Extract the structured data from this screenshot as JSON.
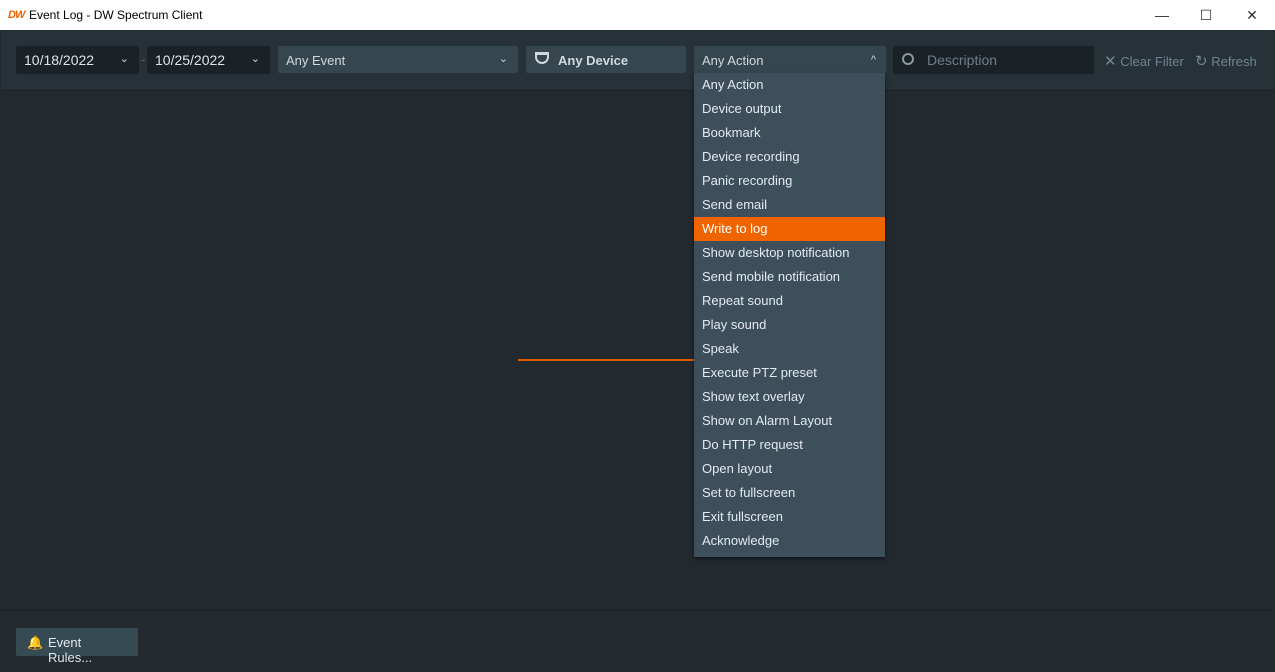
{
  "window": {
    "title": "Event Log - DW Spectrum Client",
    "logo": "DW"
  },
  "filters": {
    "date_from": "10/18/2022",
    "date_sep": "-",
    "date_to": "10/25/2022",
    "event": "Any Event",
    "device": "Any Device",
    "action": "Any Action",
    "description_placeholder": "Description",
    "clear_filter": "Clear Filter",
    "refresh": "Refresh"
  },
  "action_menu": {
    "selected_index": 6,
    "items": [
      "Any Action",
      "Device output",
      "Bookmark",
      "Device recording",
      "Panic recording",
      "Send email",
      "Write to log",
      "Show desktop notification",
      "Send mobile notification",
      "Repeat sound",
      "Play sound",
      "Speak",
      "Execute PTZ preset",
      "Show text overlay",
      "Show on Alarm Layout",
      "Do HTTP request",
      "Open layout",
      "Set to fullscreen",
      "Exit fullscreen",
      "Acknowledge"
    ]
  },
  "footer": {
    "event_rules": "Event Rules..."
  },
  "colors": {
    "accent": "#f06400"
  }
}
